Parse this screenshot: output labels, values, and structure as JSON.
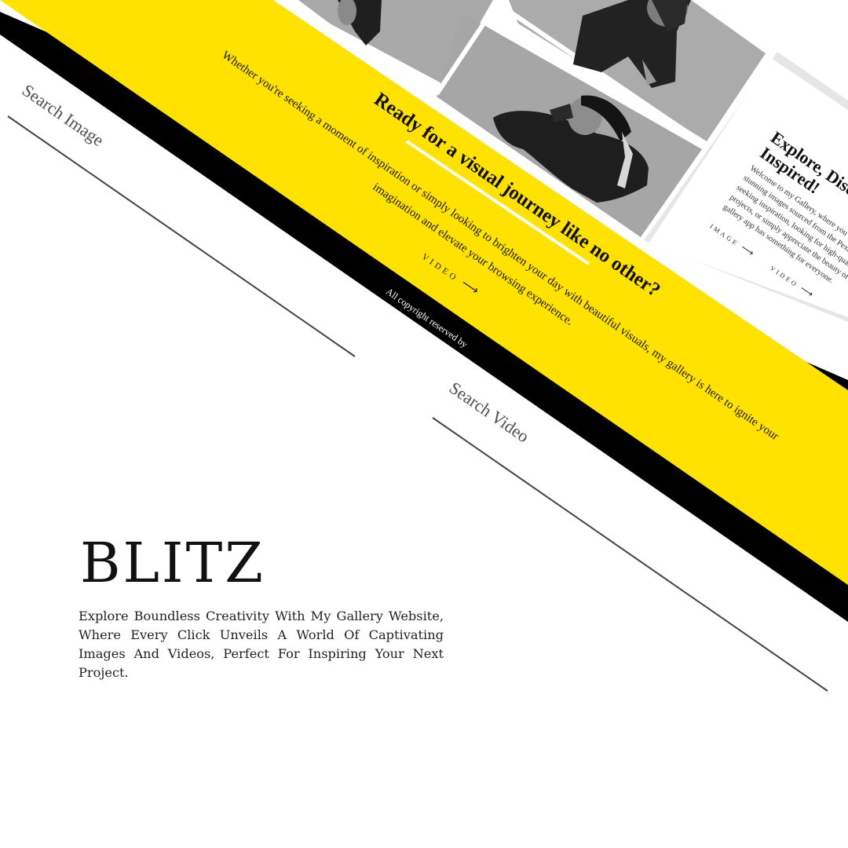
{
  "left_panel": {
    "search_image_label": "Search Image",
    "search_video_label": "Search Video"
  },
  "hero": {
    "title": "Ready for a visual journey like no other?",
    "description_line1": "Whether you're seeking a moment of inspiration or simply looking to brighten your day with beautiful visuals, my gallery is here to ignite your",
    "description_line2": "imagination and elevate your browsing experience.",
    "video_link": "VIDEO"
  },
  "footer": {
    "copyright": "All copyright reserved by"
  },
  "info_card": {
    "title_line1": "Explore, Disc",
    "title_line2": "Inspired!",
    "desc_lines": [
      "Welcome to my Gallery, where you can",
      "stunning images sourced from the Pexels",
      "seeking inspiration, looking for high-quality",
      "projects, or simply appreciate the beauty of ph",
      "gallery app has something for everyone."
    ],
    "image_link": "IMAGE",
    "video_link": "VIDEO"
  },
  "brand": {
    "name": "BLITZ",
    "tagline": "Explore Boundless Creativity With My Gallery Website, Where Every Click Unveils A World Of Captivating Images And Videos, Perfect For Inspiring Your Next Project."
  },
  "colors": {
    "accent_yellow": "#FFE200",
    "band_black": "#000000",
    "photo_gray": "#a8a8a8"
  },
  "icons": {
    "arrow": "right-arrow-icon"
  }
}
